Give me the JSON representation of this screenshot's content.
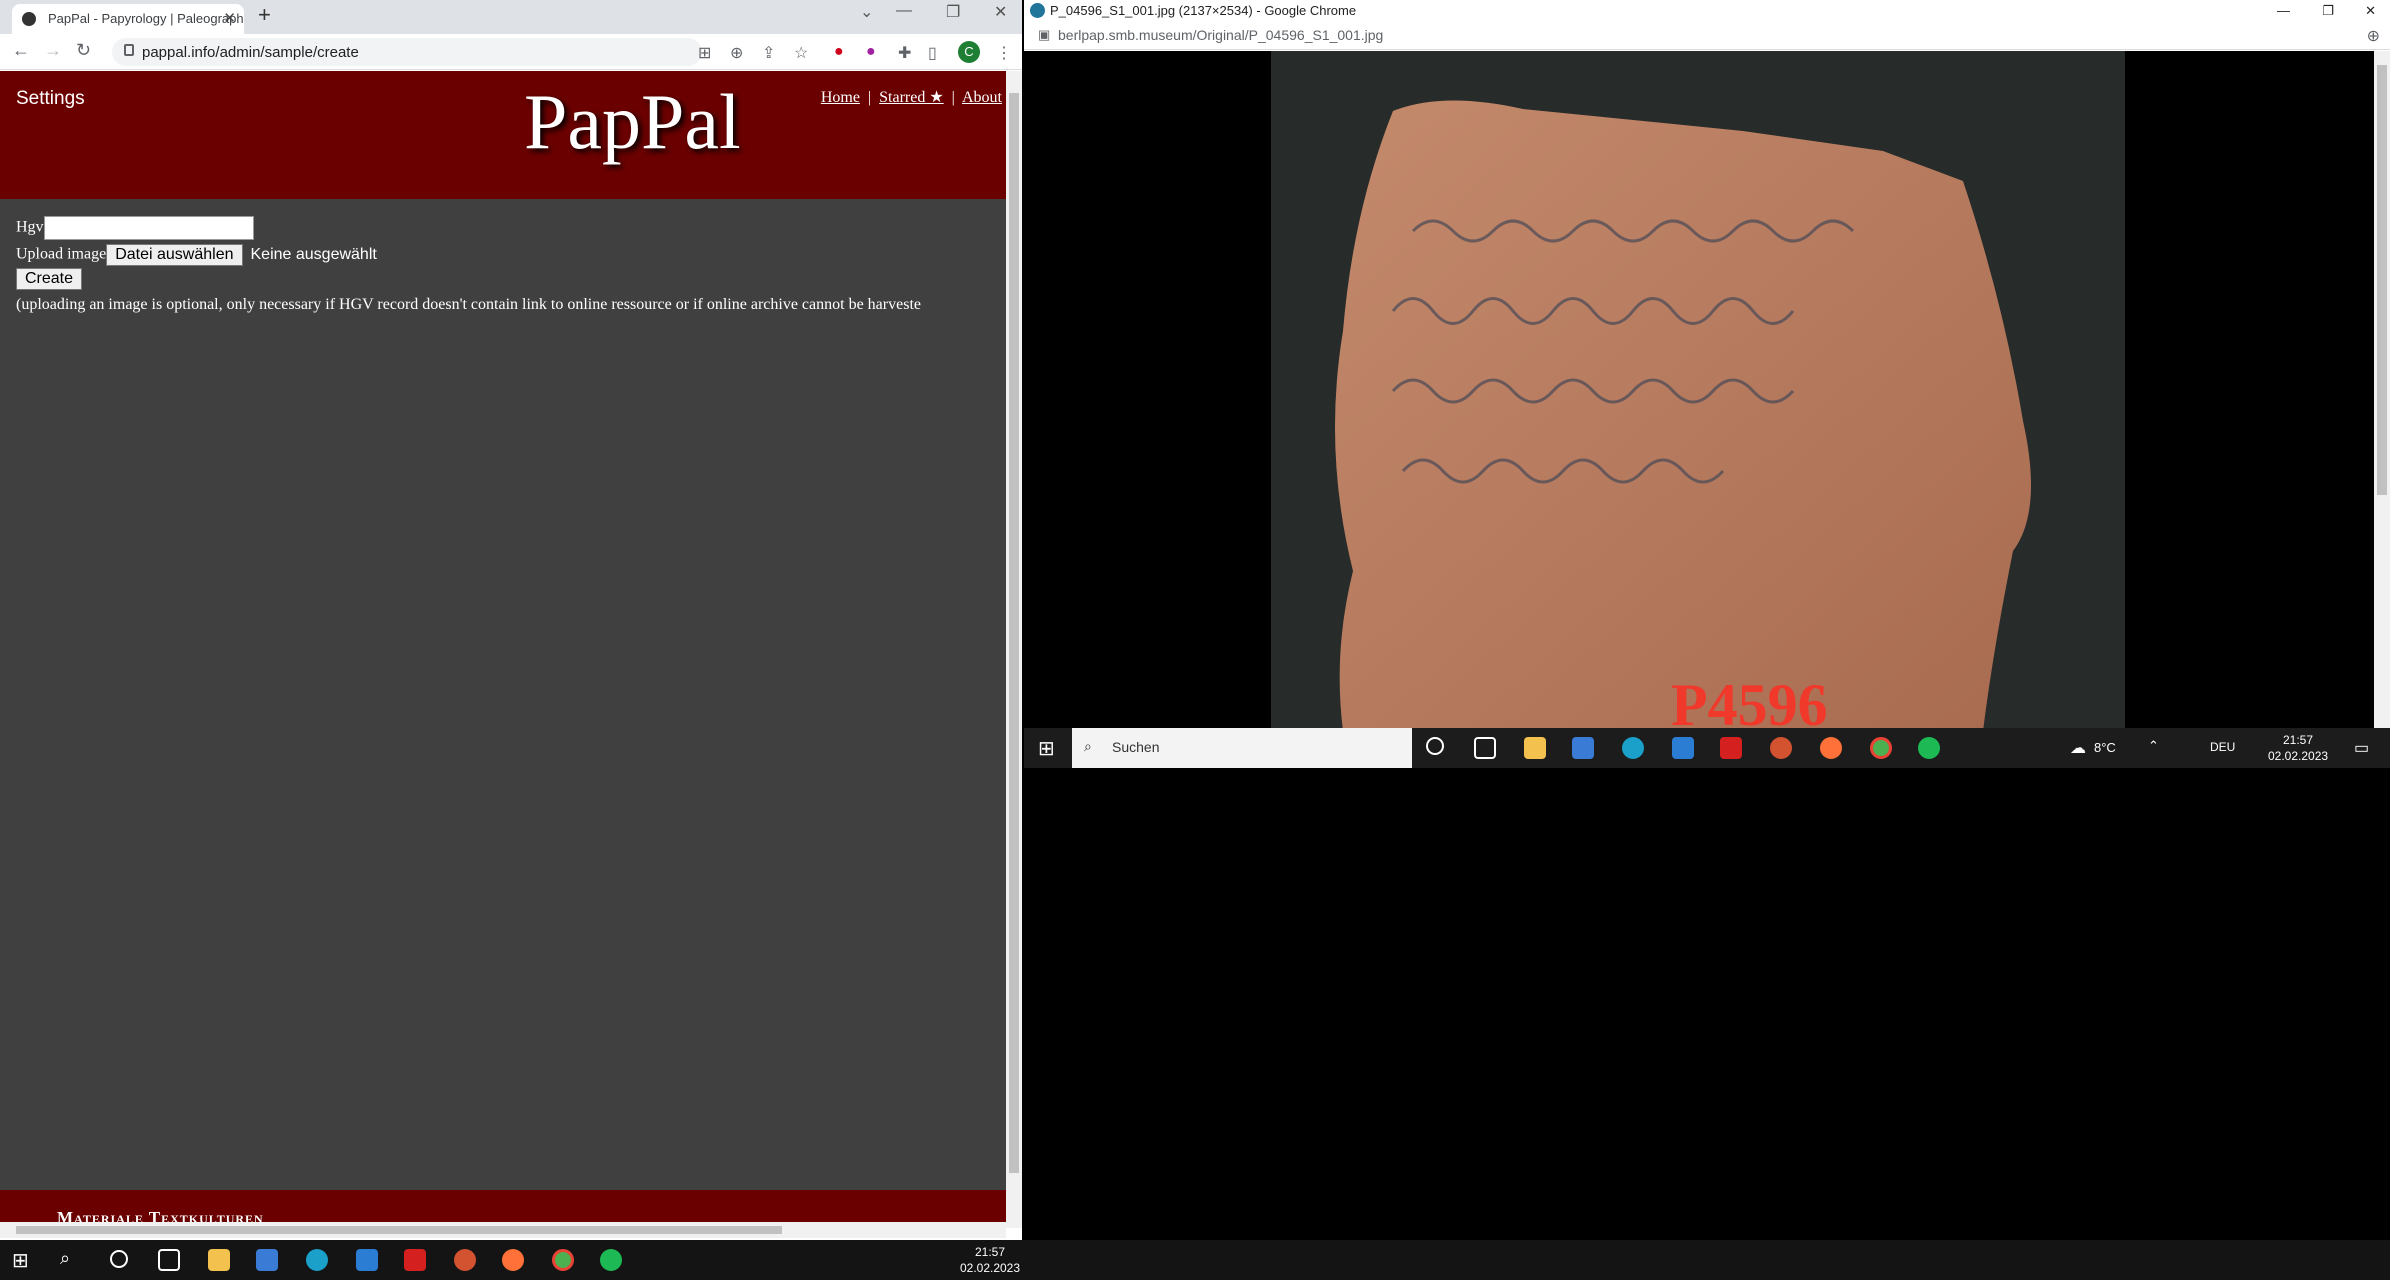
{
  "left_window": {
    "tab_title": "PapPal - Papyrology | Paleograph",
    "url": "pappal.info/admin/sample/create",
    "avatar_letter": "C"
  },
  "pappal": {
    "settings_label": "Settings",
    "logo": "PapPal",
    "nav": [
      "Home",
      "Starred ★",
      "About"
    ],
    "hgv_label": "Hgv",
    "upload_label": "Upload image",
    "file_button": "Datei auswählen",
    "file_status": "Keine ausgewählt",
    "create_button": "Create",
    "note": "(uploading an image is optional, only necessary if HGV record doesn't contain link to online ressource or if online archive cannot be harveste",
    "footer_text": "Materiale Textkulturen"
  },
  "right_window": {
    "title": "P_04596_S1_001.jpg (2137×2534) - Google Chrome",
    "url": "berlpap.smb.museum/Original/P_04596_S1_001.jpg",
    "sticker_text": "P4596"
  },
  "taskbar_small": {
    "search_placeholder": "Suchen",
    "weather": "8°C",
    "language": "DEU",
    "time": "21:57",
    "date": "02.02.2023"
  },
  "taskbar_main": {
    "time": "21:57",
    "date": "02.02.2023"
  }
}
